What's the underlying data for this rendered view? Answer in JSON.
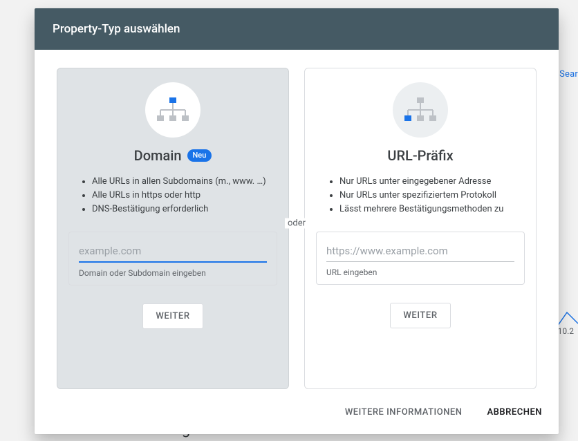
{
  "dialog": {
    "title": "Property-Typ auswählen",
    "separator": "oder",
    "footer": {
      "more_info": "WEITERE INFORMATIONEN",
      "cancel": "ABBRECHEN"
    }
  },
  "cards": {
    "domain": {
      "title": "Domain",
      "badge": "Neu",
      "bullets": [
        "Alle URLs in allen Subdomains (m., www. …)",
        "Alle URLs in https oder http",
        "DNS-Bestätigung erforderlich"
      ],
      "input_placeholder": "example.com",
      "input_hint": "Domain oder Subdomain eingeben",
      "button": "WEITER"
    },
    "url_prefix": {
      "title": "URL-Präfix",
      "bullets": [
        "Nur URLs unter eingegebener Adresse",
        "Nur URLs unter spezifiziertem Protokoll",
        "Lässt mehrere Bestätigungsmethoden zu"
      ],
      "input_placeholder": "https://www.example.com",
      "input_hint": "URL eingeben",
      "button": "WEITER"
    }
  },
  "background": {
    "right_text": "Sear",
    "tick": "10.2",
    "index_label": "Indexierung"
  },
  "icons": {
    "domain_icon": "sitemap-icon",
    "url_icon": "sitemap-icon"
  }
}
